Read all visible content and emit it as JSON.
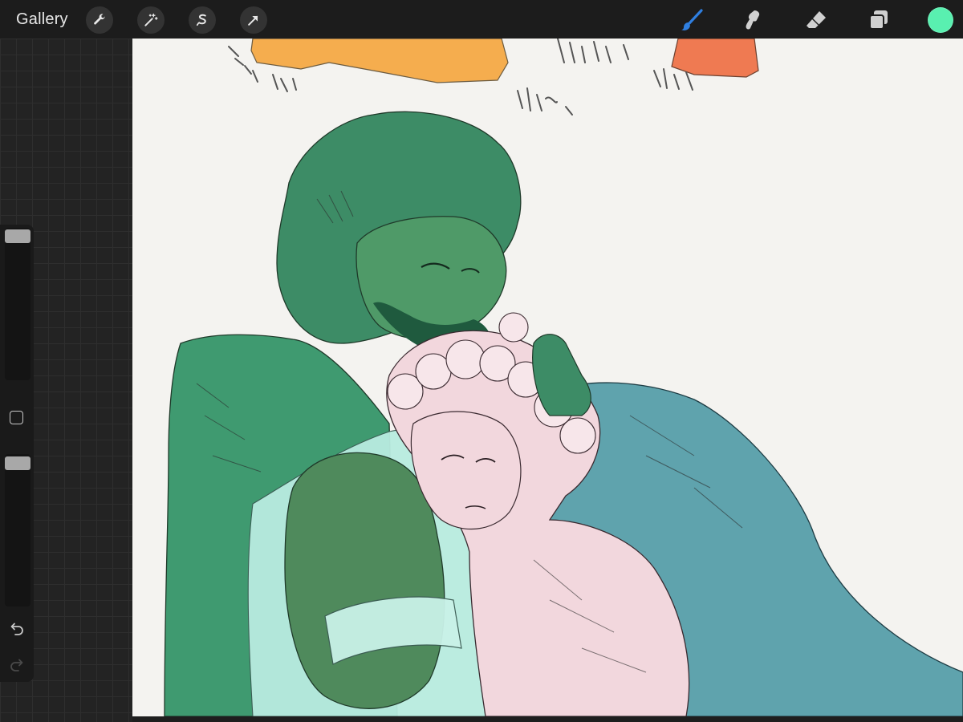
{
  "toolbar": {
    "gallery_label": "Gallery",
    "left_tools": [
      {
        "name": "actions",
        "icon": "wrench-icon"
      },
      {
        "name": "adjustments",
        "icon": "magic-wand-icon"
      },
      {
        "name": "selection",
        "icon": "selection-s-icon"
      },
      {
        "name": "transform",
        "icon": "arrow-cursor-icon"
      }
    ],
    "right_tools": [
      {
        "name": "brush",
        "icon": "brush-icon",
        "active": true
      },
      {
        "name": "smudge",
        "icon": "smudge-icon",
        "active": false
      },
      {
        "name": "eraser",
        "icon": "eraser-icon",
        "active": false
      },
      {
        "name": "layers",
        "icon": "layers-icon",
        "active": false
      }
    ],
    "active_color": "#59f0b0",
    "active_tool_color": "#2f7fe0"
  },
  "sidebar": {
    "brush_size": 0.0,
    "brush_opacity": 0.0,
    "modify_button": "square-icon",
    "undo_icon": "undo-icon",
    "redo_icon": "redo-icon"
  },
  "canvas": {
    "content": "illustration",
    "colors": {
      "green_hair": "#3d8c66",
      "green_cloak": "#3f9a70",
      "teal_cloak": "#5fa3ad",
      "pink_skin": "#f2d7dd",
      "mint_shirt": "#b9ece0",
      "olive_sleeve": "#4f8a5c",
      "orange_shape": "#f5ad4e",
      "red_shape": "#ef7a52",
      "paper": "#f4f3f0"
    }
  }
}
